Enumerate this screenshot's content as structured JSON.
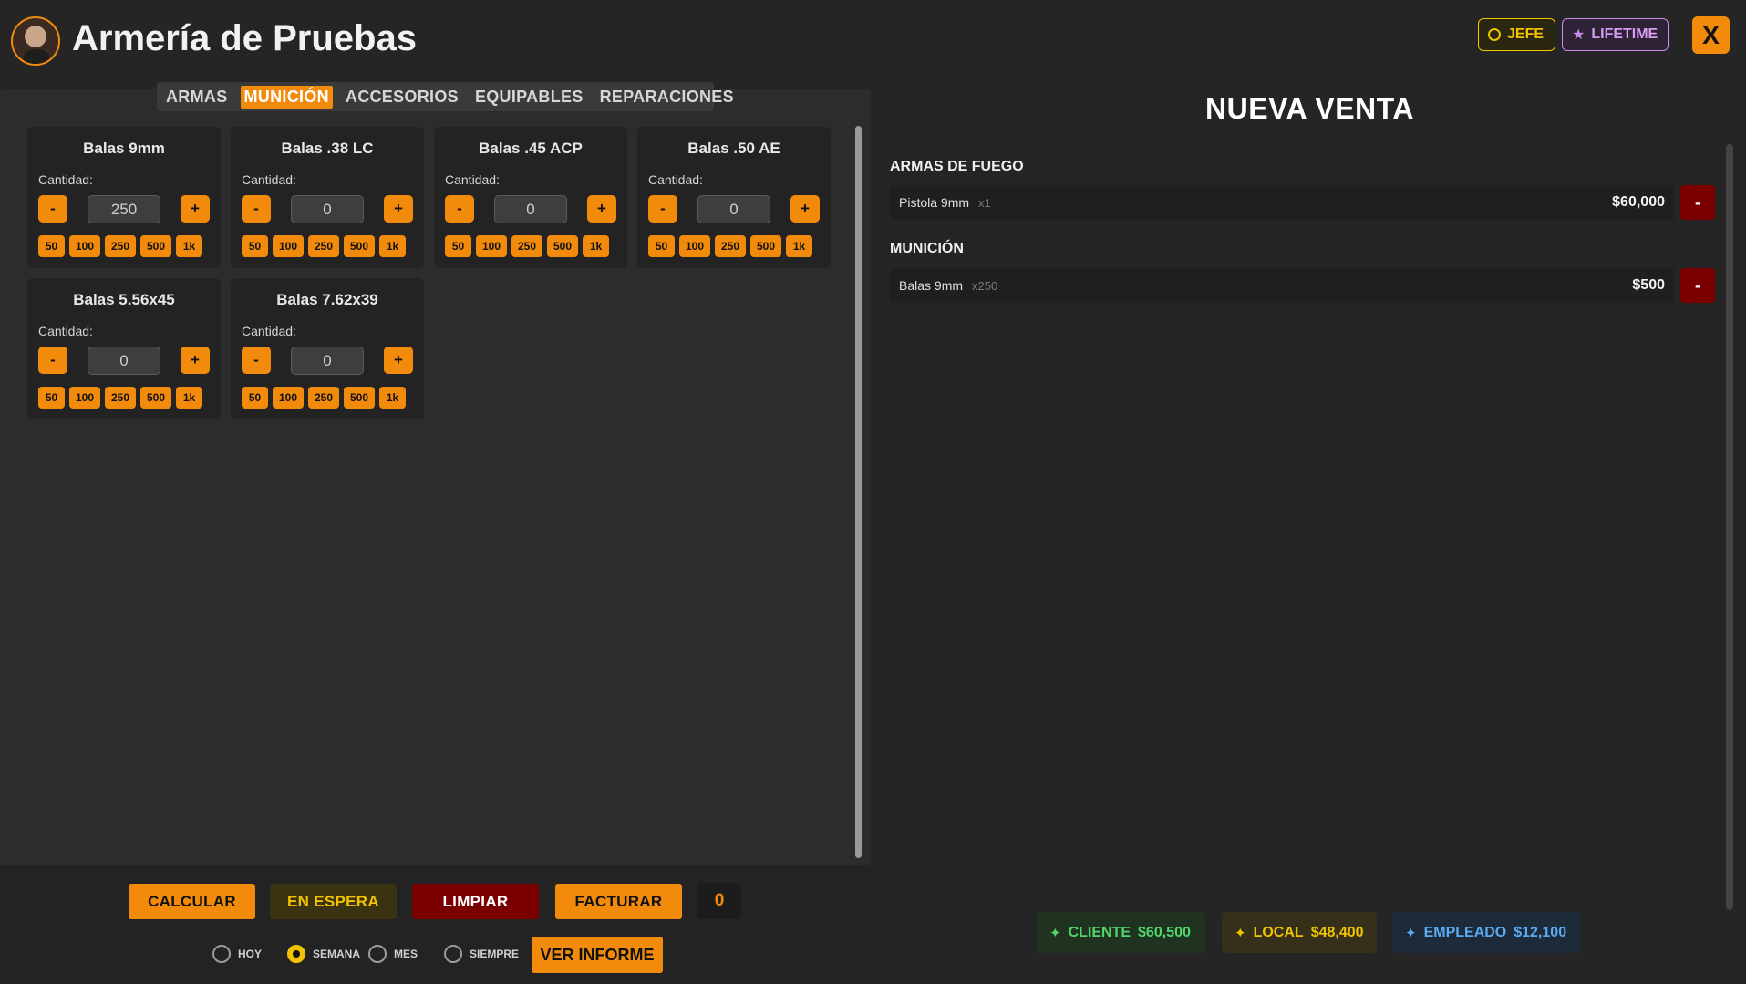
{
  "header": {
    "title": "Armería de Pruebas",
    "badges": {
      "jefe": "JEFE",
      "lifetime": "LIFETIME"
    },
    "close_label": "X"
  },
  "tabs": [
    {
      "label": "ARMAS",
      "active": false
    },
    {
      "label": "MUNICIÓN",
      "active": true
    },
    {
      "label": "ACCESORIOS",
      "active": false
    },
    {
      "label": "EQUIPABLES",
      "active": false
    },
    {
      "label": "REPARACIONES",
      "active": false
    }
  ],
  "ammo_cards": [
    {
      "title": "Balas 9mm",
      "qty_label": "Cantidad:",
      "quantity": "250"
    },
    {
      "title": "Balas .38 LC",
      "qty_label": "Cantidad:",
      "quantity": "0"
    },
    {
      "title": "Balas .45 ACP",
      "qty_label": "Cantidad:",
      "quantity": "0"
    },
    {
      "title": "Balas .50 AE",
      "qty_label": "Cantidad:",
      "quantity": "0"
    },
    {
      "title": "Balas 5.56x45",
      "qty_label": "Cantidad:",
      "quantity": "0"
    },
    {
      "title": "Balas 7.62x39",
      "qty_label": "Cantidad:",
      "quantity": "0"
    }
  ],
  "stepper": {
    "minus": "-",
    "plus": "+"
  },
  "presets": [
    "50",
    "100",
    "250",
    "500",
    "1k"
  ],
  "actions": {
    "calcular": "CALCULAR",
    "en_espera": "EN ESPERA",
    "limpiar": "LIMPIAR",
    "facturar": "FACTURAR",
    "counter": "0"
  },
  "report": {
    "periods": [
      {
        "label": "HOY",
        "checked": false
      },
      {
        "label": "SEMANA",
        "checked": true
      },
      {
        "label": "MES",
        "checked": false
      },
      {
        "label": "SIEMPRE",
        "checked": false
      }
    ],
    "button": "VER INFORME"
  },
  "sale": {
    "title": "NUEVA VENTA",
    "sections": [
      {
        "heading": "ARMAS DE FUEGO",
        "items": [
          {
            "name": "Pistola 9mm",
            "qty": "x1",
            "price": "$60,000"
          }
        ]
      },
      {
        "heading": "MUNICIÓN",
        "items": [
          {
            "name": "Balas 9mm",
            "qty": "x250",
            "price": "$500"
          }
        ]
      }
    ],
    "remove_label": "-"
  },
  "totals": {
    "cliente": {
      "label": "CLIENTE",
      "value": "$60,500"
    },
    "local": {
      "label": "LOCAL",
      "value": "$48,400"
    },
    "empleado": {
      "label": "EMPLEADO",
      "value": "$12,100"
    }
  },
  "colors": {
    "accent": "#f28b0c",
    "danger": "#7a0000",
    "gold": "#f2c300",
    "green": "#52d66a",
    "blue": "#5caaf2",
    "purple": "#c98ae8"
  }
}
